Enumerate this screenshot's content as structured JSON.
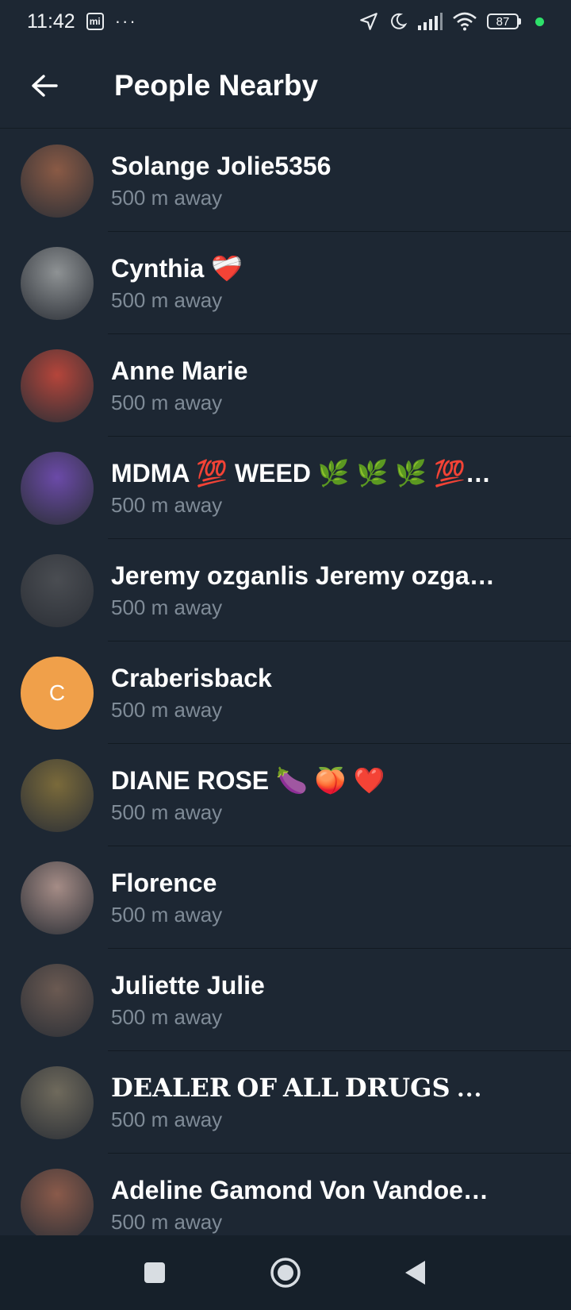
{
  "status_bar": {
    "time": "11:42",
    "calendar_glyph": "mi",
    "more_dots": "···",
    "battery_level": "87",
    "icons": [
      "calendar-icon",
      "location-arrow-icon",
      "moon-icon",
      "signal-icon",
      "wifi-icon",
      "battery-icon"
    ],
    "active_dot_color": "#2ee06a"
  },
  "app_bar": {
    "title": "People Nearby",
    "back_icon": "arrow-left-icon"
  },
  "people": [
    {
      "name": "Solange Jolie5356",
      "distance": "500 m away",
      "avatar_color": "#8a5a45"
    },
    {
      "name": "Cynthia ❤️‍🩹",
      "distance": "500 m away",
      "avatar_color": "#8e9294"
    },
    {
      "name": "Anne Marie",
      "distance": "500 m away",
      "avatar_color": "#b5453a"
    },
    {
      "name": "MDMA 💯 WEED 🌿 🌿 🌿 💯…",
      "distance": "500 m away",
      "avatar_color": "#6b4aa8"
    },
    {
      "name": "Jeremy ozganlis Jeremy ozga…",
      "distance": "500 m away",
      "avatar_color": "#4a4d52"
    },
    {
      "name": "Craberisback",
      "distance": "500 m away",
      "avatar_letter": "C",
      "avatar_color": "#f0a04a"
    },
    {
      "name": "DIANE ROSE 🍆 🍑 ❤️",
      "distance": "500 m away",
      "avatar_color": "#7a6a3a"
    },
    {
      "name": "Florence",
      "distance": "500 m away",
      "avatar_color": "#a58c86"
    },
    {
      "name": "Juliette Julie",
      "distance": "500 m away",
      "avatar_color": "#6b5a52"
    },
    {
      "name": "𝐃𝐄𝐀𝐋𝐄𝐑 𝐎𝐅 𝐀𝐋𝐋 𝐃𝐑𝐔𝐆𝐒 ❄️…",
      "distance": "500 m away",
      "avatar_color": "#6f6a5c"
    },
    {
      "name": "Adeline Gamond Von Vandoeu…",
      "distance": "500 m away",
      "avatar_color": "#8a5a4a"
    }
  ],
  "nav_bar": {
    "buttons": [
      "square-recents-icon",
      "circle-home-icon",
      "triangle-back-icon"
    ]
  }
}
